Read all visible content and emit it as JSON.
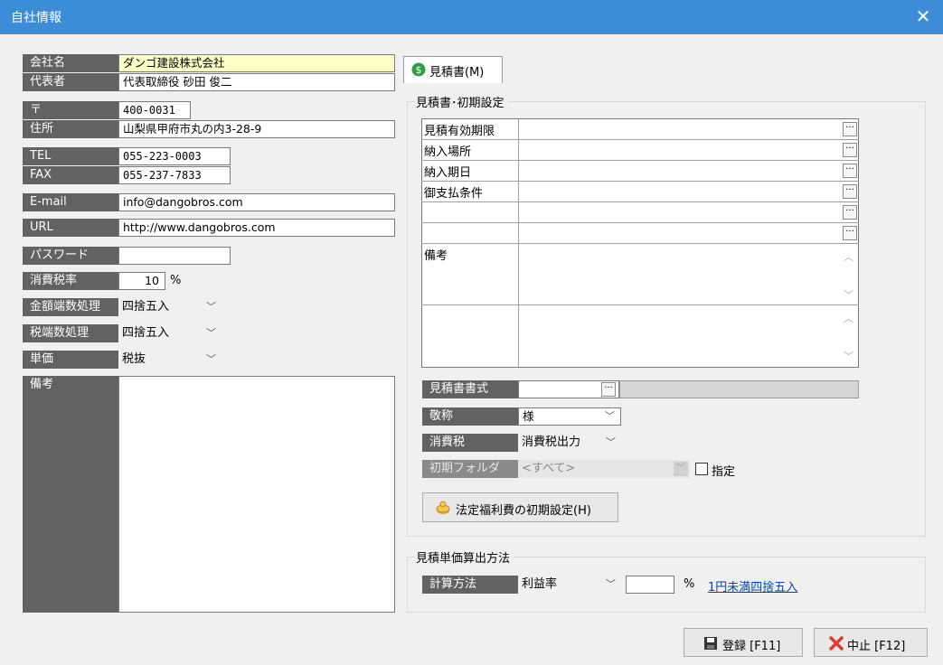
{
  "window": {
    "title": "自社情報",
    "close_label": "✕"
  },
  "company": {
    "name_label": "会社名",
    "name_value": "ダンゴ建設株式会社",
    "rep_label": "代表者",
    "rep_value": "代表取締役 砂田 俊二",
    "zip_label": "〒",
    "zip_value": "400-0031",
    "address_label": "住所",
    "address_value": "山梨県甲府市丸の内3-28-9",
    "tel_label": "TEL",
    "tel_value": "055-223-0003",
    "fax_label": "FAX",
    "fax_value": "055-237-7833",
    "email_label": "E-mail",
    "email_value": "info@dangobros.com",
    "url_label": "URL",
    "url_value": "http://www.dangobros.com",
    "password_label": "パスワード",
    "password_value": "",
    "tax_label": "消費税率",
    "tax_value": "10",
    "tax_unit": "%",
    "amount_rounding_label": "金額端数処理",
    "amount_rounding_value": "四捨五入",
    "tax_rounding_label": "税端数処理",
    "tax_rounding_value": "四捨五入",
    "unit_price_label": "単価",
    "unit_price_value": "税抜",
    "notes_label": "備考"
  },
  "tab": {
    "label": "見積書(M)"
  },
  "estimate": {
    "section_title": "見積書･初期設定",
    "rows": [
      {
        "label": "見積有効期限",
        "value": ""
      },
      {
        "label": "納入場所",
        "value": ""
      },
      {
        "label": "納入期日",
        "value": ""
      },
      {
        "label": "御支払条件",
        "value": ""
      },
      {
        "label": "",
        "value": ""
      },
      {
        "label": "",
        "value": ""
      }
    ],
    "notes_label": "備考",
    "format_label": "見積書書式",
    "honorific_label": "敬称",
    "honorific_value": "様",
    "tax_label": "消費税",
    "tax_value": "消費税出力",
    "folder_label": "初期フォルダ",
    "folder_value": "<すべて>",
    "specify_label": "指定",
    "welfare_button_label": "法定福利費の初期設定(H)"
  },
  "calc": {
    "section_title": "見積単価算出方法",
    "method_label": "計算方法",
    "method_value": "利益率",
    "percent_value": "",
    "percent_unit": "%",
    "rounding_link": "1円未満四捨五入"
  },
  "footer": {
    "register_label": "登録 [F11]",
    "cancel_label": "中止 [F12]"
  },
  "colors": {
    "titlebar": "#3c8dd8",
    "label_bg": "#626262",
    "name_highlight": "#ffffc8"
  }
}
